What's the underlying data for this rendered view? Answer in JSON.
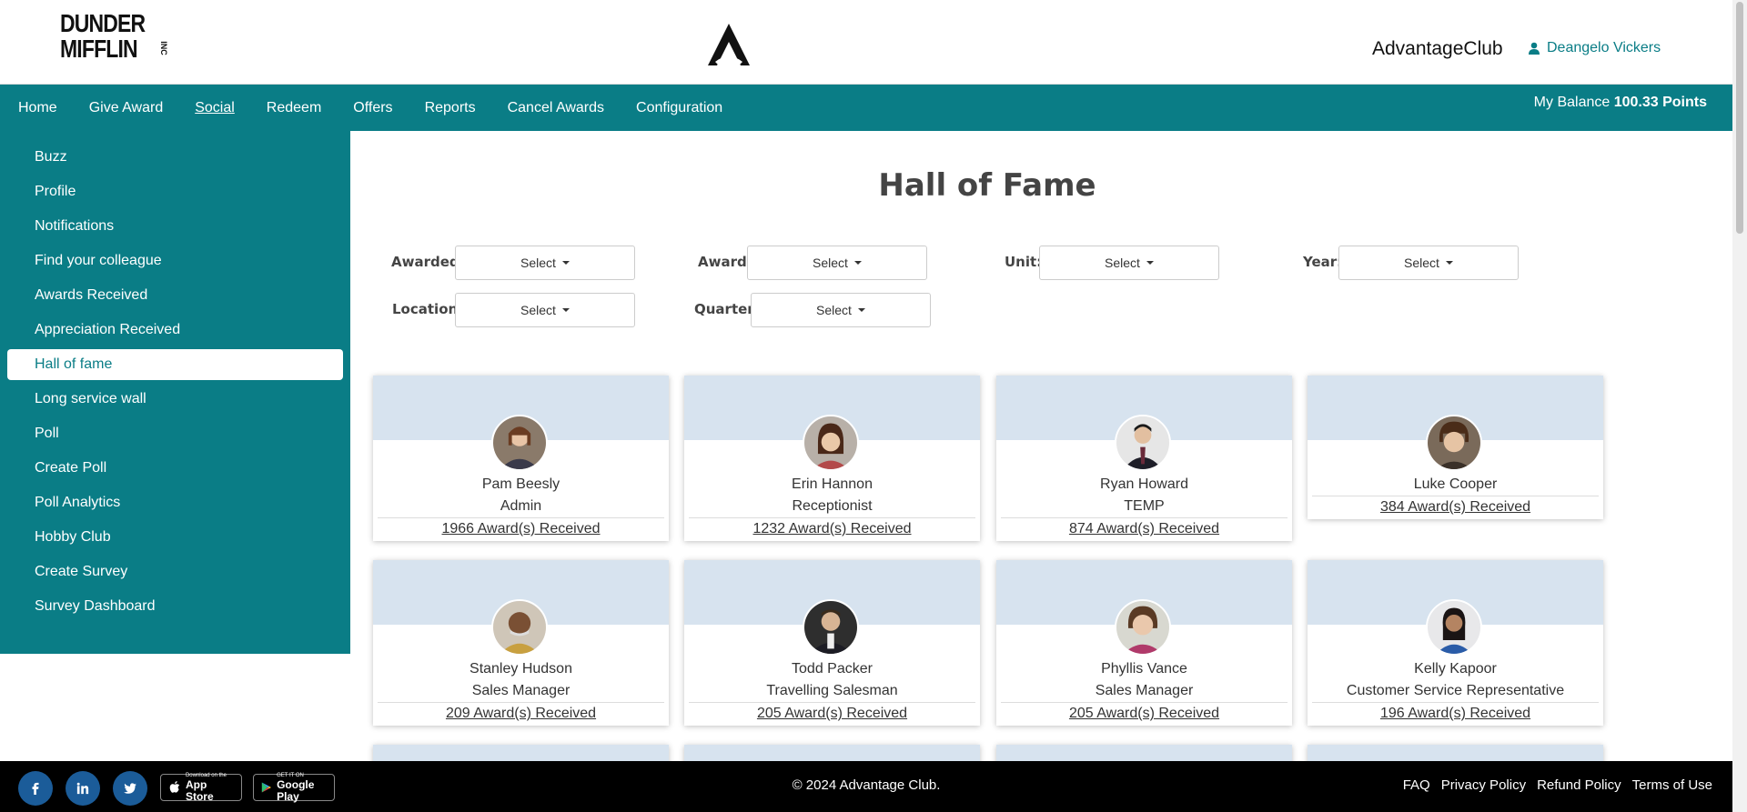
{
  "header": {
    "logo_line1": "DUNDER",
    "logo_line2": "MIFFLIN",
    "logo_inc": "INC",
    "brand": "AdvantageClub",
    "user_name": "Deangelo Vickers"
  },
  "nav": {
    "items": [
      {
        "label": "Home"
      },
      {
        "label": "Give Award"
      },
      {
        "label": "Social"
      },
      {
        "label": "Redeem"
      },
      {
        "label": "Offers"
      },
      {
        "label": "Reports"
      },
      {
        "label": "Cancel Awards"
      },
      {
        "label": "Configuration"
      }
    ],
    "active": "Social",
    "balance_label": "My Balance",
    "balance_value": "100.33 Points"
  },
  "sidebar": {
    "items": [
      {
        "label": "Buzz"
      },
      {
        "label": "Profile"
      },
      {
        "label": "Notifications"
      },
      {
        "label": "Find your colleague"
      },
      {
        "label": "Awards Received"
      },
      {
        "label": "Appreciation Received"
      },
      {
        "label": "Hall of fame"
      },
      {
        "label": "Long service wall"
      },
      {
        "label": "Poll"
      },
      {
        "label": "Create Poll"
      },
      {
        "label": "Poll Analytics"
      },
      {
        "label": "Hobby Club"
      },
      {
        "label": "Create Survey"
      },
      {
        "label": "Survey Dashboard"
      }
    ],
    "active": "Hall of fame"
  },
  "main": {
    "title": "Hall of Fame",
    "filters": {
      "awarded_label": "Awarded:",
      "award_label": "Award:",
      "unit_label": "Unit:",
      "year_label": "Year:",
      "location_label": "Location:",
      "quarter_label": "Quarter:",
      "select_text": "Select"
    },
    "cards": [
      {
        "name": "Pam Beesly",
        "role": "Admin",
        "awards": "1966 Award(s) Received"
      },
      {
        "name": "Erin Hannon",
        "role": "Receptionist",
        "awards": "1232 Award(s) Received"
      },
      {
        "name": "Ryan Howard",
        "role": "TEMP",
        "awards": "874 Award(s) Received"
      },
      {
        "name": "Luke Cooper",
        "role": "",
        "awards": "384 Award(s) Received"
      },
      {
        "name": "Stanley Hudson",
        "role": "Sales Manager",
        "awards": "209 Award(s) Received"
      },
      {
        "name": "Todd Packer",
        "role": "Travelling Salesman",
        "awards": "205 Award(s) Received"
      },
      {
        "name": "Phyllis Vance",
        "role": "Sales Manager",
        "awards": "205 Award(s) Received"
      },
      {
        "name": "Kelly Kapoor",
        "role": "Customer Service Representative",
        "awards": "196 Award(s) Received"
      }
    ]
  },
  "footer": {
    "copyright": "© 2024 Advantage Club.",
    "app_store_small": "Download on the",
    "app_store_big": "App Store",
    "google_play_small": "GET IT ON",
    "google_play_big": "Google Play",
    "links": [
      {
        "label": "FAQ"
      },
      {
        "label": "Privacy Policy"
      },
      {
        "label": "Refund Policy"
      },
      {
        "label": "Terms of Use"
      }
    ]
  },
  "colors": {
    "primary": "#0a7d86",
    "card_header": "#d7e3ef",
    "footer": "#000000",
    "social_icon_bg": "#1b5c99"
  }
}
